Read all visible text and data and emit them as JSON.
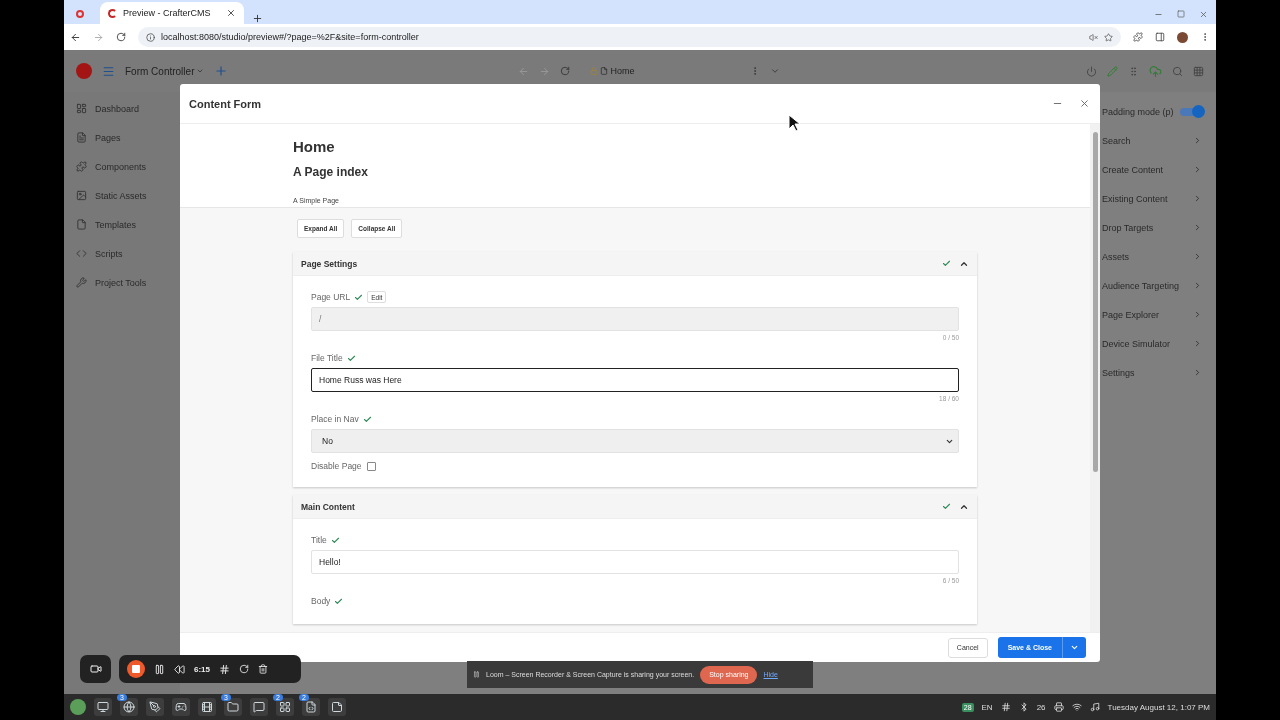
{
  "browser": {
    "tab_title": "Preview - CrafterCMS",
    "url": "localhost:8080/studio/preview#/?page=%2F&site=form-controller"
  },
  "toolbar": {
    "site": "Form Controller",
    "address": "Home"
  },
  "sidebar": {
    "items": [
      {
        "label": "Dashboard"
      },
      {
        "label": "Pages"
      },
      {
        "label": "Components"
      },
      {
        "label": "Static Assets"
      },
      {
        "label": "Templates"
      },
      {
        "label": "Scripts"
      },
      {
        "label": "Project Tools"
      }
    ]
  },
  "right_panel": {
    "padding_mode": {
      "label": "Padding mode (p)",
      "on": true
    },
    "items": [
      {
        "label": "Search"
      },
      {
        "label": "Create Content"
      },
      {
        "label": "Existing Content"
      },
      {
        "label": "Drop Targets"
      },
      {
        "label": "Assets"
      },
      {
        "label": "Audience Targeting"
      },
      {
        "label": "Page Explorer"
      },
      {
        "label": "Device Simulator"
      },
      {
        "label": "Settings"
      }
    ]
  },
  "dialog": {
    "title": "Content Form",
    "heading": "Home",
    "subheading": "A Page index",
    "description": "A Simple Page",
    "buttons": [
      "Expand All",
      "Collapse All"
    ],
    "sections": [
      {
        "title": "Page Settings",
        "valid": true,
        "expanded": true,
        "fields": [
          {
            "kind": "text",
            "label": "Page URL",
            "valid": true,
            "action": "Edit",
            "placeholder": "/",
            "disabled": true,
            "focused": false,
            "counter": "0 / 50"
          },
          {
            "kind": "text",
            "label": "File Title",
            "valid": true,
            "value": "Home Russ was Here",
            "disabled": false,
            "focused": true,
            "counter": "18 / 60"
          },
          {
            "kind": "select",
            "label": "Place in Nav",
            "valid": true,
            "value": "No"
          },
          {
            "kind": "checkbox",
            "label": "Disable Page",
            "checked": false
          }
        ]
      },
      {
        "title": "Main Content",
        "valid": true,
        "expanded": true,
        "fields": [
          {
            "kind": "text",
            "label": "Title",
            "valid": true,
            "value": "Hello!",
            "disabled": false,
            "focused": false,
            "counter": "6 / 50"
          },
          {
            "kind": "label",
            "label": "Body",
            "valid": true
          }
        ]
      }
    ],
    "footer": {
      "cancel": "Cancel",
      "save": "Save & Close"
    }
  },
  "loom": {
    "time": "6:15",
    "message": "Loom – Screen Recorder & Screen Capture is sharing your screen.",
    "stop": "Stop sharing",
    "hide": "Hide"
  },
  "taskbar": {
    "apps": [
      {
        "kind": "monitor"
      },
      {
        "kind": "browser",
        "badge": "3"
      },
      {
        "kind": "editor"
      },
      {
        "kind": "game"
      },
      {
        "kind": "media"
      },
      {
        "kind": "files",
        "badge": "3"
      },
      {
        "kind": "chat"
      },
      {
        "kind": "windows",
        "badge": "2"
      },
      {
        "kind": "code",
        "badge": "2"
      },
      {
        "kind": "notes"
      }
    ],
    "calendar": "28",
    "language": "EN",
    "count": "26",
    "clock": "Tuesday August 12, 1:07 PM"
  }
}
